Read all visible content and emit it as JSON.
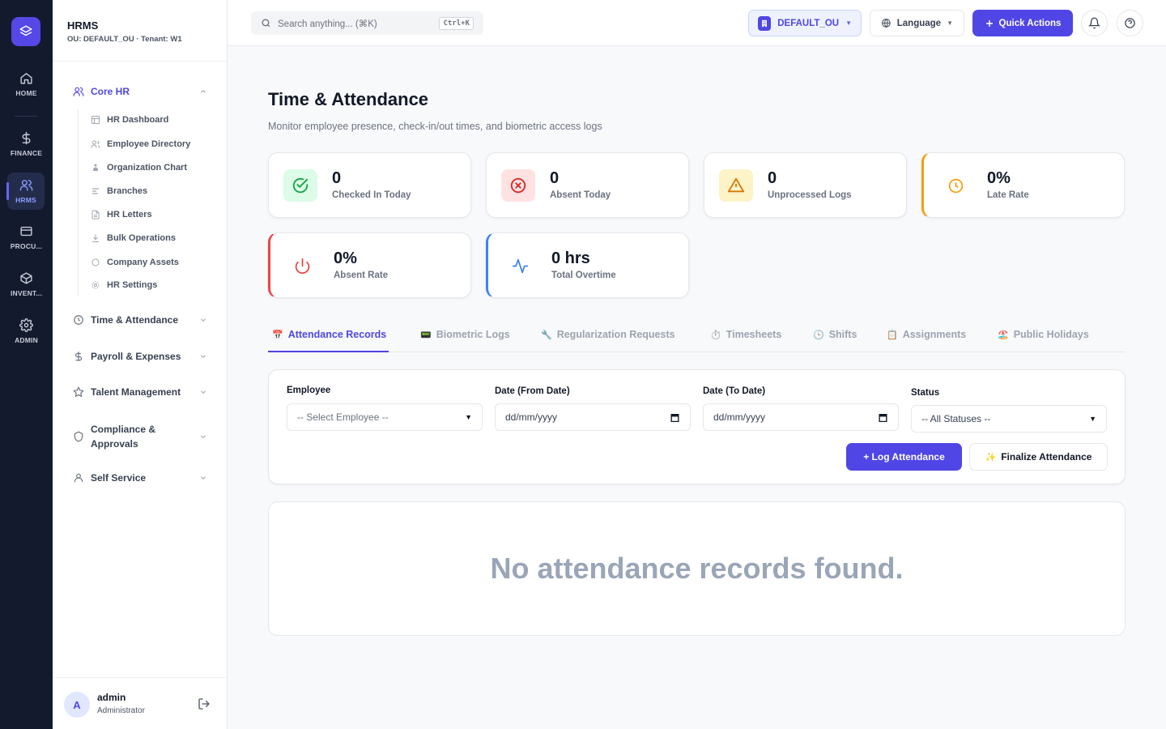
{
  "rail": {
    "items": [
      {
        "label": "HOME",
        "icon": "home-icon"
      },
      {
        "label": "FINANCE",
        "icon": "dollar-icon"
      },
      {
        "label": "HRMS",
        "icon": "users-icon"
      },
      {
        "label": "PROCU...",
        "icon": "card-icon"
      },
      {
        "label": "INVENT...",
        "icon": "box-icon"
      },
      {
        "label": "ADMIN",
        "icon": "gear-icon"
      }
    ],
    "active": "HRMS"
  },
  "sidebar": {
    "title": "HRMS",
    "subtitle": "OU: DEFAULT_OU · Tenant: W1",
    "groups": [
      {
        "label": "Core HR",
        "open": true
      },
      {
        "label": "Time & Attendance"
      },
      {
        "label": "Payroll & Expenses"
      },
      {
        "label": "Talent Management"
      },
      {
        "label": "Compliance & Approvals"
      },
      {
        "label": "Self Service"
      }
    ],
    "core_items": [
      {
        "label": "HR Dashboard"
      },
      {
        "label": "Employee Directory"
      },
      {
        "label": "Organization Chart"
      },
      {
        "label": "Branches"
      },
      {
        "label": "HR Letters"
      },
      {
        "label": "Bulk Operations"
      },
      {
        "label": "Company Assets"
      },
      {
        "label": "HR Settings"
      }
    ],
    "user": {
      "initial": "A",
      "name": "admin",
      "role": "Administrator"
    }
  },
  "topbar": {
    "search_placeholder": "Search anything... (⌘K)",
    "shortcut": "Ctrl+K",
    "ou": "DEFAULT_OU",
    "language": "Language",
    "quick_actions": "Quick Actions"
  },
  "page": {
    "title": "Time & Attendance",
    "subtitle": "Monitor employee presence, check-in/out times, and biometric access logs"
  },
  "stats": [
    {
      "value": "0",
      "label": "Checked In Today",
      "color": "#16a34a"
    },
    {
      "value": "0",
      "label": "Absent Today",
      "color": "#dc2626"
    },
    {
      "value": "0",
      "label": "Unprocessed Logs",
      "color": "#d97706"
    },
    {
      "value": "0%",
      "label": "Late Rate",
      "color": "#f59e0b"
    },
    {
      "value": "0%",
      "label": "Absent Rate",
      "color": "#ef4444"
    },
    {
      "value": "0 hrs",
      "label": "Total Overtime",
      "color": "#3b82f6"
    }
  ],
  "tabs": [
    {
      "label": "Attendance Records",
      "emoji": "📅",
      "active": true
    },
    {
      "label": "Biometric Logs",
      "emoji": "📟"
    },
    {
      "label": "Regularization Requests",
      "emoji": "🔧"
    },
    {
      "label": "Timesheets",
      "emoji": "⏱️"
    },
    {
      "label": "Shifts",
      "emoji": "🕒"
    },
    {
      "label": "Assignments",
      "emoji": "📋"
    },
    {
      "label": "Public Holidays",
      "emoji": "🏖️"
    }
  ],
  "filters": {
    "employee_label": "Employee",
    "employee_value": "-- Select Employee --",
    "from_label": "Date (From Date)",
    "from_value": "dd/mm/yyyy",
    "to_label": "Date (To Date)",
    "to_value": "dd/mm/yyyy",
    "status_label": "Status",
    "status_value": "-- All Statuses --",
    "log_button": "+ Log Attendance",
    "finalize_button": "Finalize Attendance",
    "finalize_emoji": "✨"
  },
  "empty_message": "No attendance records found."
}
